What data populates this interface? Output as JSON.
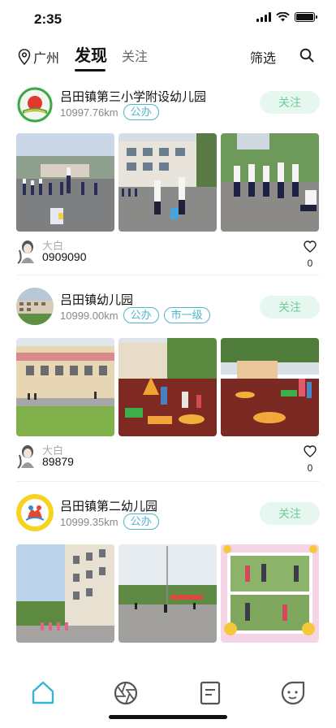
{
  "status": {
    "time": "2:35"
  },
  "nav": {
    "location": "广州",
    "tab_discover": "发现",
    "tab_follow": "关注",
    "filter": "筛选"
  },
  "colors": {
    "accent": "#4fb5cc",
    "follow_bg": "#e6f7ef",
    "follow_text": "#6ecb99"
  },
  "posts": [
    {
      "school": "吕田镇第三小学附设幼儿园",
      "distance": "10997.76km",
      "tags": [
        "公办"
      ],
      "follow": "关注",
      "author_nick": "大白",
      "author_code": "0909090",
      "likes": "0"
    },
    {
      "school": "吕田镇幼儿园",
      "distance": "10999.00km",
      "tags": [
        "公办",
        "市一级"
      ],
      "follow": "关注",
      "author_nick": "大白",
      "author_code": "89879",
      "likes": "0"
    },
    {
      "school": "吕田镇第二幼儿园",
      "distance": "10999.35km",
      "tags": [
        "公办"
      ],
      "follow": "关注"
    }
  ],
  "tabbar": [
    "home-icon",
    "camera-aperture-icon",
    "document-icon",
    "smiley-icon"
  ]
}
